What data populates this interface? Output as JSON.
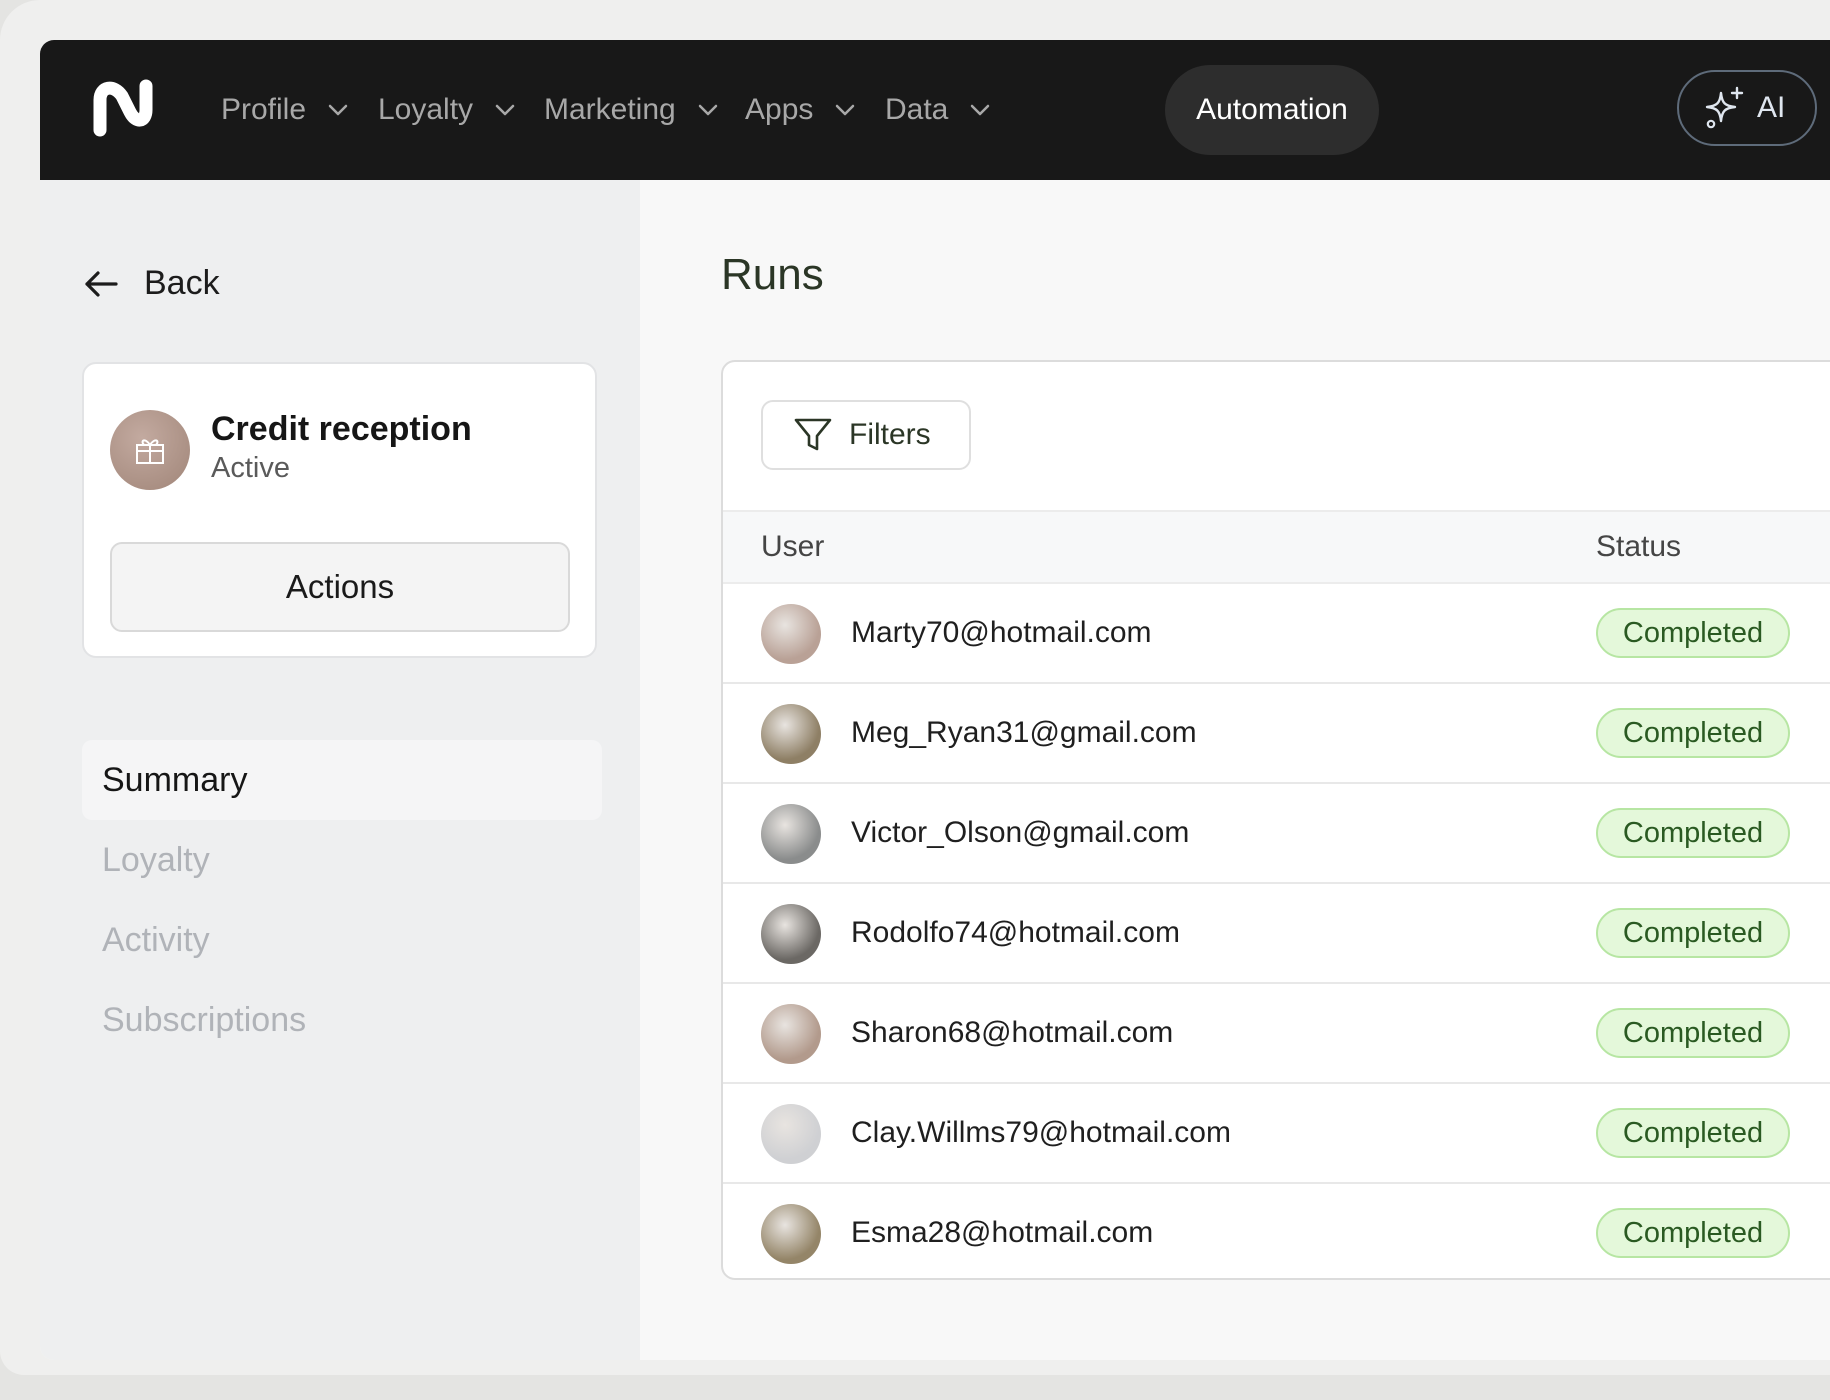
{
  "topbar": {
    "nav": [
      {
        "label": "Profile"
      },
      {
        "label": "Loyalty"
      },
      {
        "label": "Marketing"
      },
      {
        "label": "Apps"
      },
      {
        "label": "Data"
      }
    ],
    "active_nav": "Automation",
    "ai_label": "AI"
  },
  "sidebar": {
    "back_label": "Back",
    "card": {
      "title": "Credit reception",
      "status": "Active",
      "actions_label": "Actions"
    },
    "items": [
      {
        "label": "Summary",
        "active": true
      },
      {
        "label": "Loyalty",
        "active": false
      },
      {
        "label": "Activity",
        "active": false
      },
      {
        "label": "Subscriptions",
        "active": false
      }
    ]
  },
  "main": {
    "title": "Runs",
    "filters_label": "Filters",
    "columns": {
      "user": "User",
      "status": "Status"
    },
    "rows": [
      {
        "email": "Marty70@hotmail.com",
        "status": "Completed",
        "avatar_color": "#b9a196"
      },
      {
        "email": "Meg_Ryan31@gmail.com",
        "status": "Completed",
        "avatar_color": "#8e7f65"
      },
      {
        "email": "Victor_Olson@gmail.com",
        "status": "Completed",
        "avatar_color": "#8a8c8c"
      },
      {
        "email": "Rodolfo74@hotmail.com",
        "status": "Completed",
        "avatar_color": "#6b6864"
      },
      {
        "email": "Sharon68@hotmail.com",
        "status": "Completed",
        "avatar_color": "#b29a8c"
      },
      {
        "email": "Clay.Willms79@hotmail.com",
        "status": "Completed",
        "avatar_color": "#cfd0d3"
      },
      {
        "email": "Esma28@hotmail.com",
        "status": "Completed",
        "avatar_color": "#948568"
      }
    ]
  },
  "colors": {
    "topbar_bg": "#181818",
    "badge_bg": "#e4f8da",
    "badge_border": "#b7e6a3",
    "badge_text": "#2a5a22",
    "title_text": "#2b3626"
  },
  "icons": {
    "logo": "n-logo-icon",
    "ai": "sparkle-icon",
    "back": "arrow-left-icon",
    "card": "gift-icon",
    "filters": "funnel-icon",
    "nav_chevron": "chevron-down-icon"
  }
}
